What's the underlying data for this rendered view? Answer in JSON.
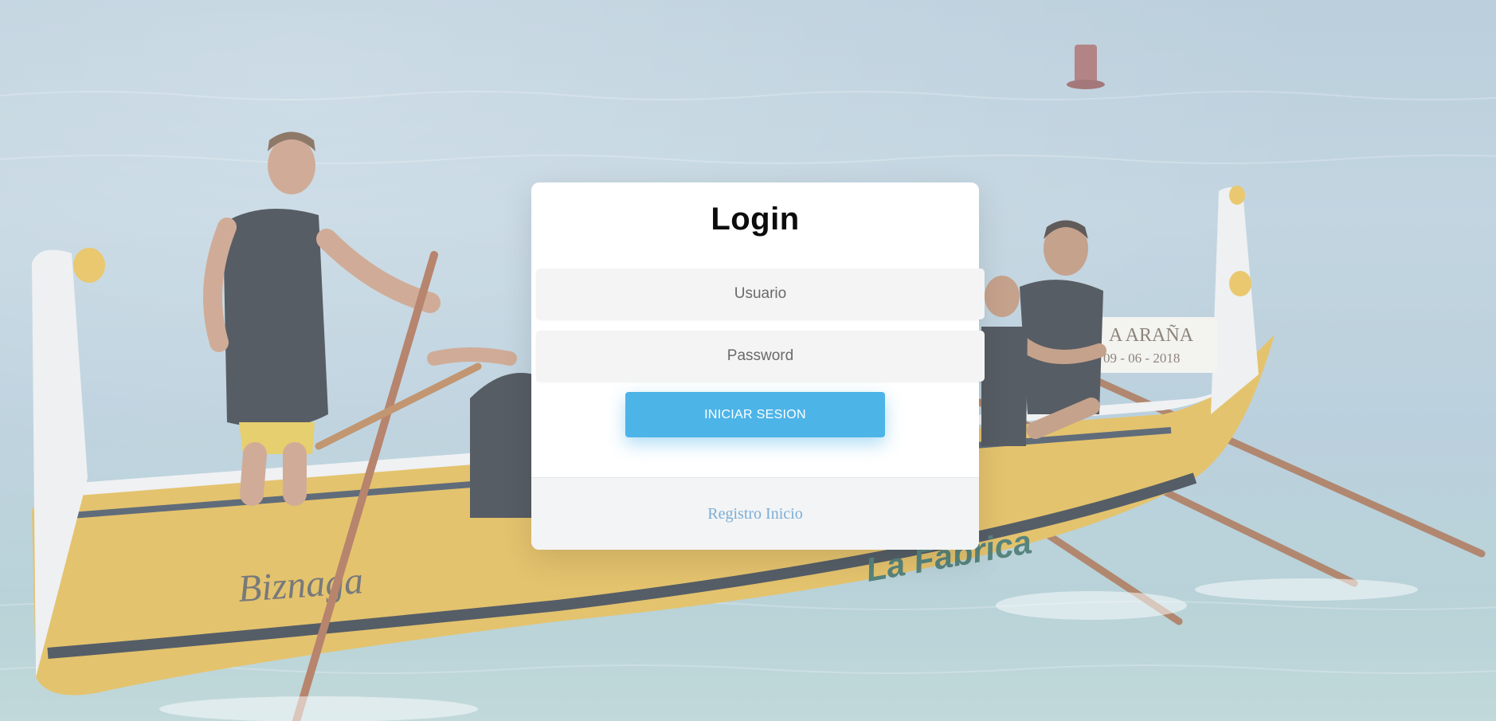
{
  "login": {
    "title": "Login",
    "username_placeholder": "Usuario",
    "password_placeholder": "Password",
    "submit_label": "INICIAR SESION",
    "register_link": "Registro Inicio"
  },
  "background": {
    "description_icon": "rowing-boat-photo",
    "boat_side_text": "La Fabrica",
    "boat_name_text": "Biznaga",
    "plaque_text_line1": "A ARAÑA",
    "plaque_text_line2": "09 - 06 - 2018"
  },
  "colors": {
    "accent": "#4db4e8",
    "link": "#7aaed8",
    "card_bg": "#ffffff",
    "footer_bg": "#f3f4f5",
    "boat_yellow": "#e2b23a"
  }
}
